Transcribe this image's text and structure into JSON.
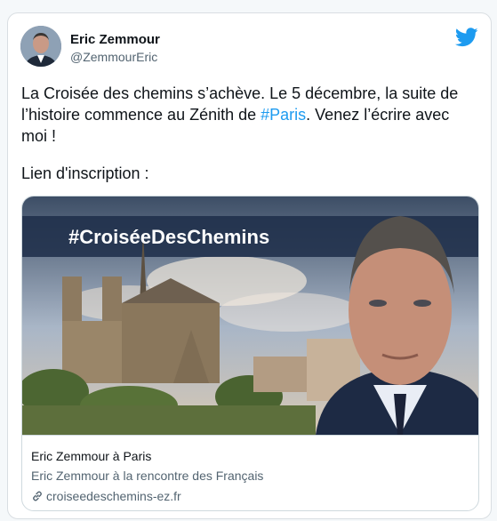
{
  "tweet": {
    "author_name": "Eric Zemmour",
    "author_handle": "@ZemmourEric",
    "text_before": "La Croisée des chemins s’achève. Le 5 décembre, la suite de l’histoire commence au Zénith de ",
    "hashtag": "#Paris",
    "text_after": ". Venez l’écrire avec moi !",
    "lien": "Lien d'inscription :"
  },
  "card": {
    "banner_hashtag": "#CroiséeDesChemins",
    "title": "Eric Zemmour à Paris",
    "description": "Eric Zemmour à la rencontre des Français",
    "url": "croiseedeschemins-ez.fr"
  },
  "colors": {
    "twitter_blue": "#1d9bf0",
    "text": "#0f1419",
    "muted": "#536471"
  },
  "icons": {
    "brand": "twitter-bird-icon",
    "link": "link-icon"
  }
}
